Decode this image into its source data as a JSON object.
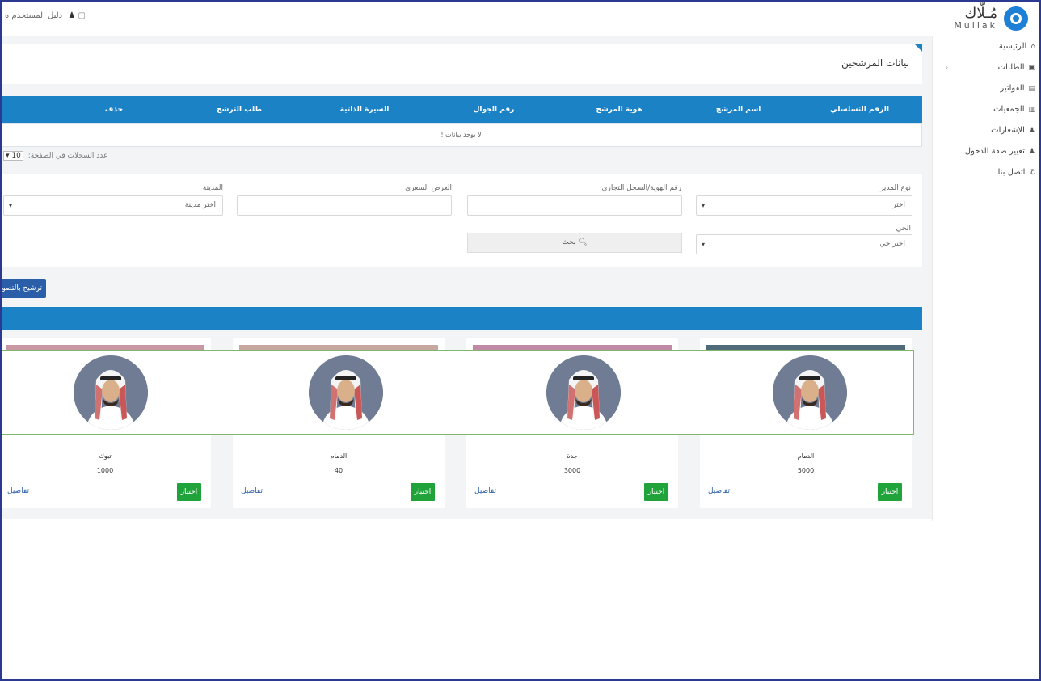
{
  "topbar": {
    "logo_ar": "مُـلّاك",
    "logo_en": "Mullak",
    "user_label": "دليل المستخدم ه"
  },
  "sidebar": {
    "items": [
      {
        "label": "الرئيسية",
        "icon": "home-icon"
      },
      {
        "label": "الطلبات",
        "icon": "requests-icon"
      },
      {
        "label": "الفواتير",
        "icon": "invoice-icon"
      },
      {
        "label": "الجمعيات",
        "icon": "building-icon"
      },
      {
        "label": "الإشعارات",
        "icon": "bell-icon"
      },
      {
        "label": "تغيير صفة الدخول",
        "icon": "user-switch-icon"
      },
      {
        "label": "اتصل بنا",
        "icon": "phone-icon"
      }
    ]
  },
  "main": {
    "page_title": "بيانات المرشحين",
    "table": {
      "headers": [
        "الرقم التسلسلي",
        "اسم المرشح",
        "هوية المرشح",
        "رقم الجوال",
        "السيرة الذاتية",
        "طلب الترشح",
        "حذف"
      ],
      "empty_message": "لا يوجد بيانات !"
    },
    "page_size_label": "عدد السجلات في الصفحة:",
    "page_size_value": "10",
    "filters": {
      "manager_type_label": "نوع المدير",
      "manager_type_value": "اختر",
      "id_label": "رقم الهوية/السجل التجاري",
      "price_label": "العرض السعري",
      "city_label": "المدينة",
      "city_value": "اختر مدينة",
      "district_label": "الحي",
      "district_value": "اختر حي",
      "search_label": "بحث"
    },
    "compare_button": "ترشيح بالتصويت"
  },
  "cards": [
    {
      "city": "الدمام",
      "value": "5000",
      "choose": "اختيار",
      "details": "تفاصيل"
    },
    {
      "city": "جدة",
      "value": "3000",
      "choose": "اختيار",
      "details": "تفاصيل"
    },
    {
      "city": "الدمام",
      "value": "40",
      "choose": "اختيار",
      "details": "تفاصيل"
    },
    {
      "city": "تبوك",
      "value": "1000",
      "choose": "اختيار",
      "details": "تفاصيل"
    }
  ],
  "colors": {
    "primary_blue": "#1b82c5",
    "button_green": "#1fa33a",
    "frame": "#2b3990",
    "compare_button": "#2b5ea8"
  }
}
